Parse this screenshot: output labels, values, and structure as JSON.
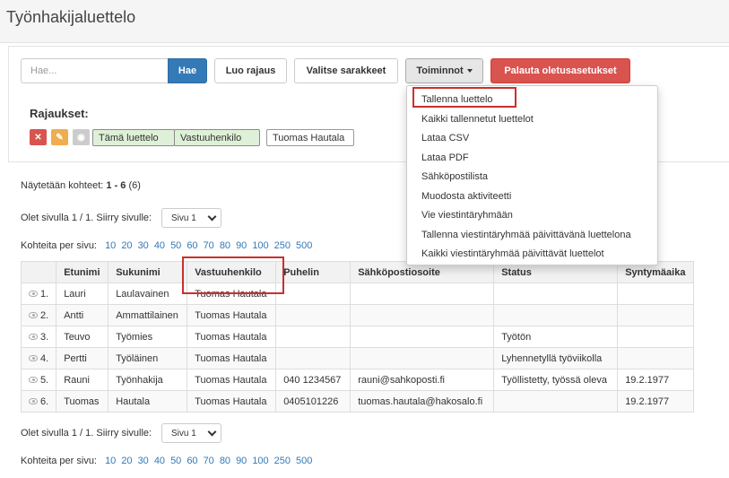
{
  "page": {
    "title": "Työnhakijaluettelo"
  },
  "toolbar": {
    "search_placeholder": "Hae...",
    "search_button": "Hae",
    "create_filter": "Luo rajaus",
    "select_columns": "Valitse sarakkeet",
    "actions": "Toiminnot",
    "reset_defaults": "Palauta oletusasetukset"
  },
  "filters": {
    "title": "Rajaukset:",
    "tags": [
      "Tämä luettelo",
      "Vastuuhenkilo",
      "Tuomas Hautala"
    ]
  },
  "info": {
    "showing_prefix": "Näytetään kohteet:",
    "showing_range": "1 - 6",
    "showing_total": "(6)",
    "page_text": "Olet sivulla 1 / 1. Siirry sivulle:",
    "page_select": "Sivu 1",
    "per_page_label": "Kohteita per sivu:",
    "per_page_options": [
      "10",
      "20",
      "30",
      "40",
      "50",
      "60",
      "70",
      "80",
      "90",
      "100",
      "250",
      "500"
    ]
  },
  "actions_menu": [
    "Tallenna luettelo",
    "Kaikki tallennetut luettelot",
    "Lataa CSV",
    "Lataa PDF",
    "Sähköpostilista",
    "Muodosta aktiviteetti",
    "Vie viestintäryhmään",
    "Tallenna viestintäryhmää päivittävänä luettelona",
    "Kaikki viestintäryhmää päivittävät luettelot"
  ],
  "table": {
    "headers": [
      "",
      "Etunimi",
      "Sukunimi",
      "Vastuuhenkilo",
      "Puhelin",
      "Sähköpostiosoite",
      "Status",
      "Syntymäaika"
    ],
    "rows": [
      [
        "1.",
        "Lauri",
        "Laulavainen",
        "Tuomas Hautala",
        "",
        "",
        "",
        ""
      ],
      [
        "2.",
        "Antti",
        "Ammattilainen",
        "Tuomas Hautala",
        "",
        "",
        "",
        ""
      ],
      [
        "3.",
        "Teuvo",
        "Työmies",
        "Tuomas Hautala",
        "",
        "",
        "Työtön",
        ""
      ],
      [
        "4.",
        "Pertti",
        "Työläinen",
        "Tuomas Hautala",
        "",
        "",
        "Lyhennetyllä työviikolla",
        ""
      ],
      [
        "5.",
        "Rauni",
        "Työnhakija",
        "Tuomas Hautala",
        "040 1234567",
        "rauni@sahkoposti.fi",
        "Työllistetty, työssä oleva",
        "19.2.1977"
      ],
      [
        "6.",
        "Tuomas",
        "Hautala",
        "Tuomas Hautala",
        "0405101226",
        "tuomas.hautala@hakosalo.fi",
        "",
        "19.2.1977"
      ]
    ]
  },
  "colors": {
    "primary": "#337ab7",
    "danger": "#d9534f",
    "highlight": "#c9302c",
    "link": "#337ab7"
  }
}
